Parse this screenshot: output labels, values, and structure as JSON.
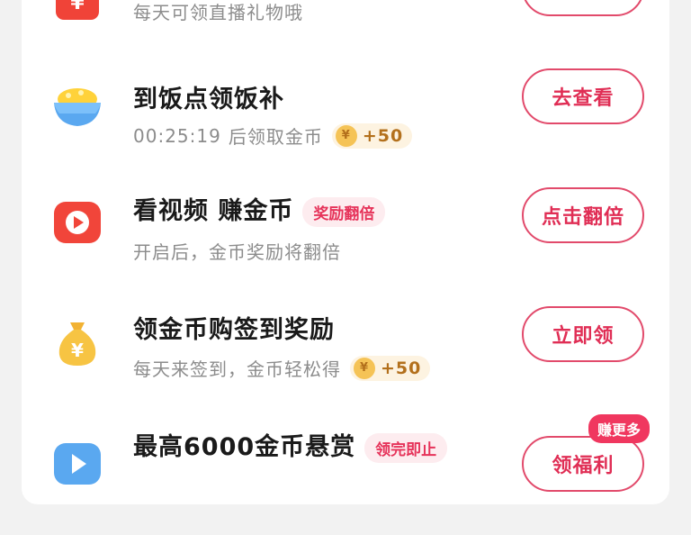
{
  "tasks": [
    {
      "title": "",
      "subtitle": "每天可领直播礼物哦",
      "button": ""
    },
    {
      "title": "到饭点领饭补",
      "countdown": "00:25:19",
      "subtitle_suffix": "后领取金币",
      "reward": "+50",
      "button": "去查看"
    },
    {
      "title": "看视频 赚金币",
      "tag": "奖励翻倍",
      "subtitle": "开启后，金币奖励将翻倍",
      "button": "点击翻倍"
    },
    {
      "title": "领金币购签到奖励",
      "subtitle": "每天来签到，金币轻松得",
      "reward": "+50",
      "button": "立即领"
    },
    {
      "title": "最高6000金币悬赏",
      "tag": "领完即止",
      "button": "领福利",
      "badge": "赚更多"
    }
  ],
  "coin_symbol": "¥",
  "colors": {
    "accent": "#e02e55",
    "tag_bg": "#fdecef",
    "reward_bg": "#fdf3e1",
    "coin": "#f5c356"
  }
}
